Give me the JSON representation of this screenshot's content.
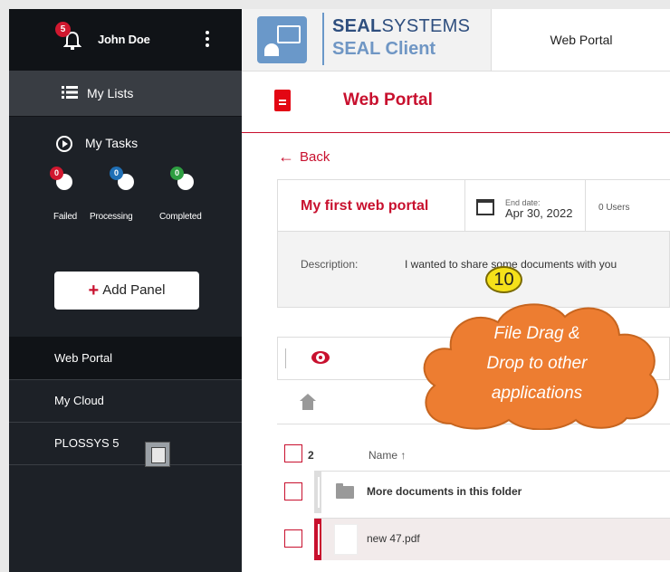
{
  "sidebar": {
    "notification_count": "5",
    "user_name": "John Doe",
    "my_lists_label": "My Lists",
    "my_tasks_label": "My Tasks",
    "tasks": [
      {
        "label": "Failed",
        "count": "0",
        "color": "#d0182f"
      },
      {
        "label": "Processing",
        "count": "0",
        "color": "#1f6fb5"
      },
      {
        "label": "Completed",
        "count": "0",
        "color": "#2e9e41"
      }
    ],
    "add_panel_plus": "+",
    "add_panel_label": "Add Panel",
    "panels": [
      "Web Portal",
      "My Cloud",
      "PLOSSYS 5"
    ]
  },
  "header": {
    "brand_bold": "SEAL",
    "brand_rest": "SYSTEMS",
    "brand_product": "SEAL Client",
    "tab_label": "Web Portal"
  },
  "page": {
    "title": "Web Portal",
    "back_arrow": "←",
    "back_label": "Back"
  },
  "portal": {
    "name": "My first web portal",
    "end_date_caption": "End date:",
    "end_date": "Apr 30, 2022",
    "users": "0 Users",
    "description_label": "Description:",
    "description": "I wanted to share some documents with you"
  },
  "files": {
    "count": "2",
    "name_header": "Name ↑",
    "rows": [
      {
        "name": "More documents in this folder",
        "type": "folder"
      },
      {
        "name": "new 47.pdf",
        "type": "pdf"
      }
    ]
  },
  "callout": {
    "number": "10",
    "lines": [
      "File Drag &",
      "Drop to other",
      "applications"
    ],
    "color": "#ed7d31"
  },
  "icons": [
    "bell-icon",
    "kebab-menu-icon",
    "list-icon",
    "play-circle-icon",
    "calendar-icon",
    "eye-icon",
    "home-icon",
    "folder-icon",
    "pdf-file-icon",
    "document-icon",
    "seal-logo-icon"
  ]
}
